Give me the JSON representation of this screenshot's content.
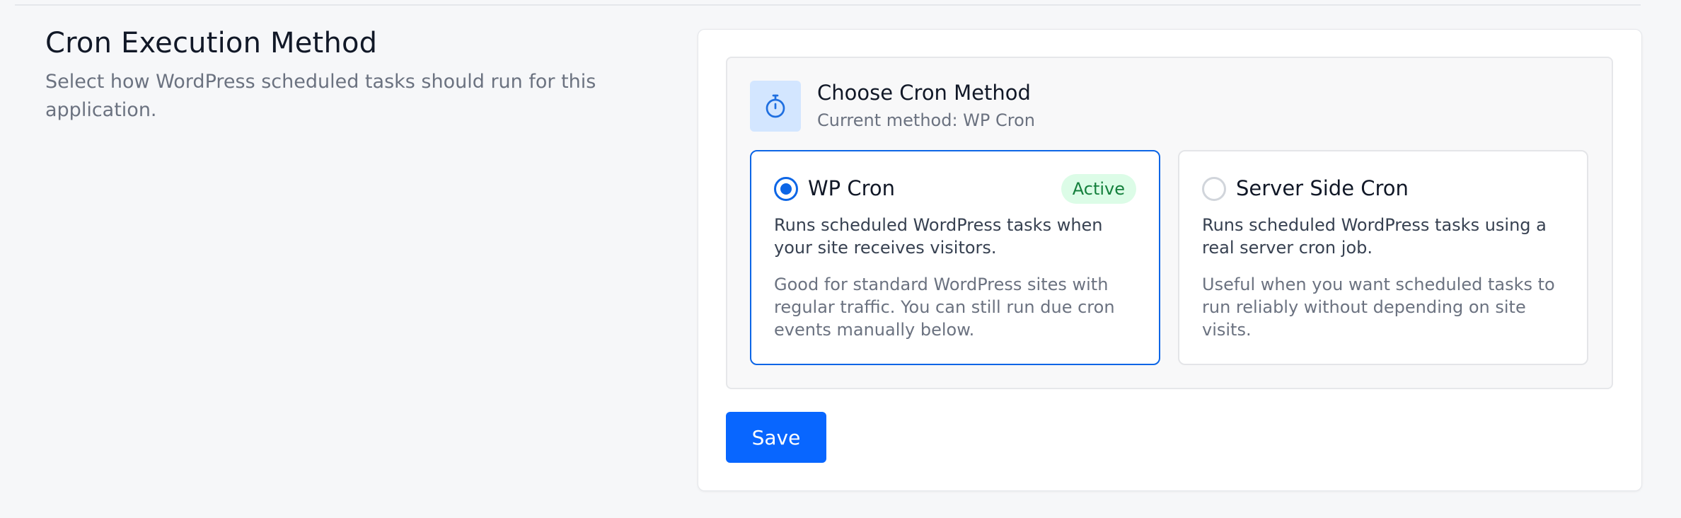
{
  "section": {
    "title": "Cron Execution Method",
    "description": "Select how WordPress scheduled tasks should run for this application."
  },
  "panel": {
    "icon": "stopwatch-icon",
    "title": "Choose Cron Method",
    "current_method": "Current method: WP Cron"
  },
  "options": [
    {
      "title": "WP Cron",
      "selected": true,
      "badge": "Active",
      "description": "Runs scheduled WordPress tasks when your site receives visitors.",
      "note": "Good for standard WordPress sites with regular traffic. You can still run due cron events manually below."
    },
    {
      "title": "Server Side Cron",
      "selected": false,
      "description": "Runs scheduled WordPress tasks using a real server cron job.",
      "note": "Useful when you want scheduled tasks to run reliably without depending on site visits."
    }
  ],
  "actions": {
    "save_label": "Save"
  },
  "colors": {
    "accent": "#0866ff",
    "selected_border": "#0d66e6",
    "active_badge_bg": "#dcfce7",
    "active_badge_text": "#15803d"
  }
}
